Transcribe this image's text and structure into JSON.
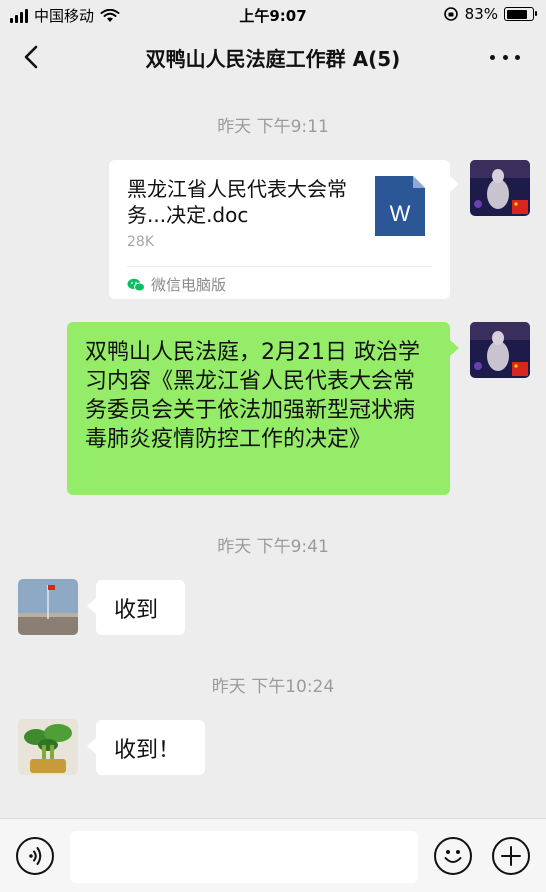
{
  "status_bar": {
    "carrier": "中国移动",
    "time": "上午9:07",
    "battery_percent": "83%",
    "battery_level": 0.83
  },
  "header": {
    "title": "双鸭山人民法庭工作群 A(5)",
    "back_icon": "chevron-left-icon",
    "more_icon": "more-dots-icon"
  },
  "messages": [
    {
      "type": "timestamp",
      "text": "昨天 下午9:11"
    },
    {
      "type": "file",
      "from": "self",
      "file_name": "黑龙江省人民代表大会常务...决定.doc",
      "file_size": "28K",
      "source": "微信电脑版",
      "icon": "word-doc-icon"
    },
    {
      "type": "text",
      "from": "self",
      "text": "双鸭山人民法庭，2月21日 政治学习内容《黑龙江省人民代表大会常务委员会关于依法加强新型冠状病毒肺炎疫情防控工作的决定》"
    },
    {
      "type": "timestamp",
      "text": "昨天 下午9:41"
    },
    {
      "type": "text",
      "from": "other",
      "text": "收到"
    },
    {
      "type": "timestamp",
      "text": "昨天 下午10:24"
    },
    {
      "type": "text",
      "from": "other",
      "text": "收到！"
    }
  ],
  "input_bar": {
    "voice_icon": "voice-icon",
    "emoji_icon": "emoji-icon",
    "plus_icon": "plus-icon"
  },
  "colors": {
    "background": "#ededed",
    "self_bubble": "#95ec69",
    "other_bubble": "#ffffff",
    "timestamp_text": "#9b9b9b",
    "word_blue": "#2b5797",
    "wechat_green": "#07c160"
  }
}
